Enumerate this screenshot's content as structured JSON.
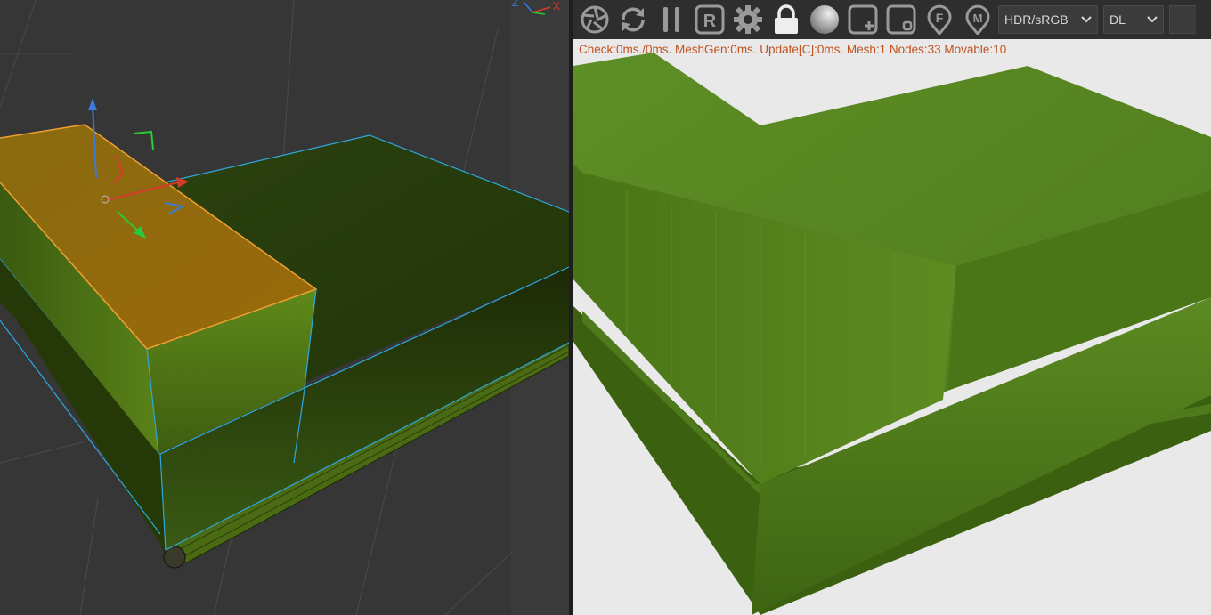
{
  "left_viewport": {
    "axis_labels": {
      "x": "X",
      "z": "Z"
    }
  },
  "toolbar": {
    "buttons": [
      {
        "name": "shutter-icon",
        "label": ""
      },
      {
        "name": "refresh-icon",
        "label": ""
      },
      {
        "name": "pause-icon",
        "label": ""
      },
      {
        "name": "r-box-icon",
        "label": "R"
      },
      {
        "name": "gear-icon",
        "label": ""
      },
      {
        "name": "lock-icon",
        "label": ""
      },
      {
        "name": "sphere-icon",
        "label": ""
      },
      {
        "name": "add-box-icon",
        "label": ""
      },
      {
        "name": "square-box-icon",
        "label": ""
      },
      {
        "name": "f-pin-icon",
        "label": "F"
      },
      {
        "name": "m-pin-icon",
        "label": "M"
      }
    ],
    "color_space": {
      "value": "HDR/sRGB"
    },
    "light_mode": {
      "value": "DL"
    }
  },
  "stats": {
    "text": "Check:0ms./0ms. MeshGen:0ms. Update[C]:0ms. Mesh:1 Nodes:33 Movable:10"
  },
  "colors": {
    "stats_text": "#c2521e",
    "selection_orange": "#f0a030",
    "wire_blue": "#2ea8e0",
    "grass_green": "#5a8a22"
  }
}
